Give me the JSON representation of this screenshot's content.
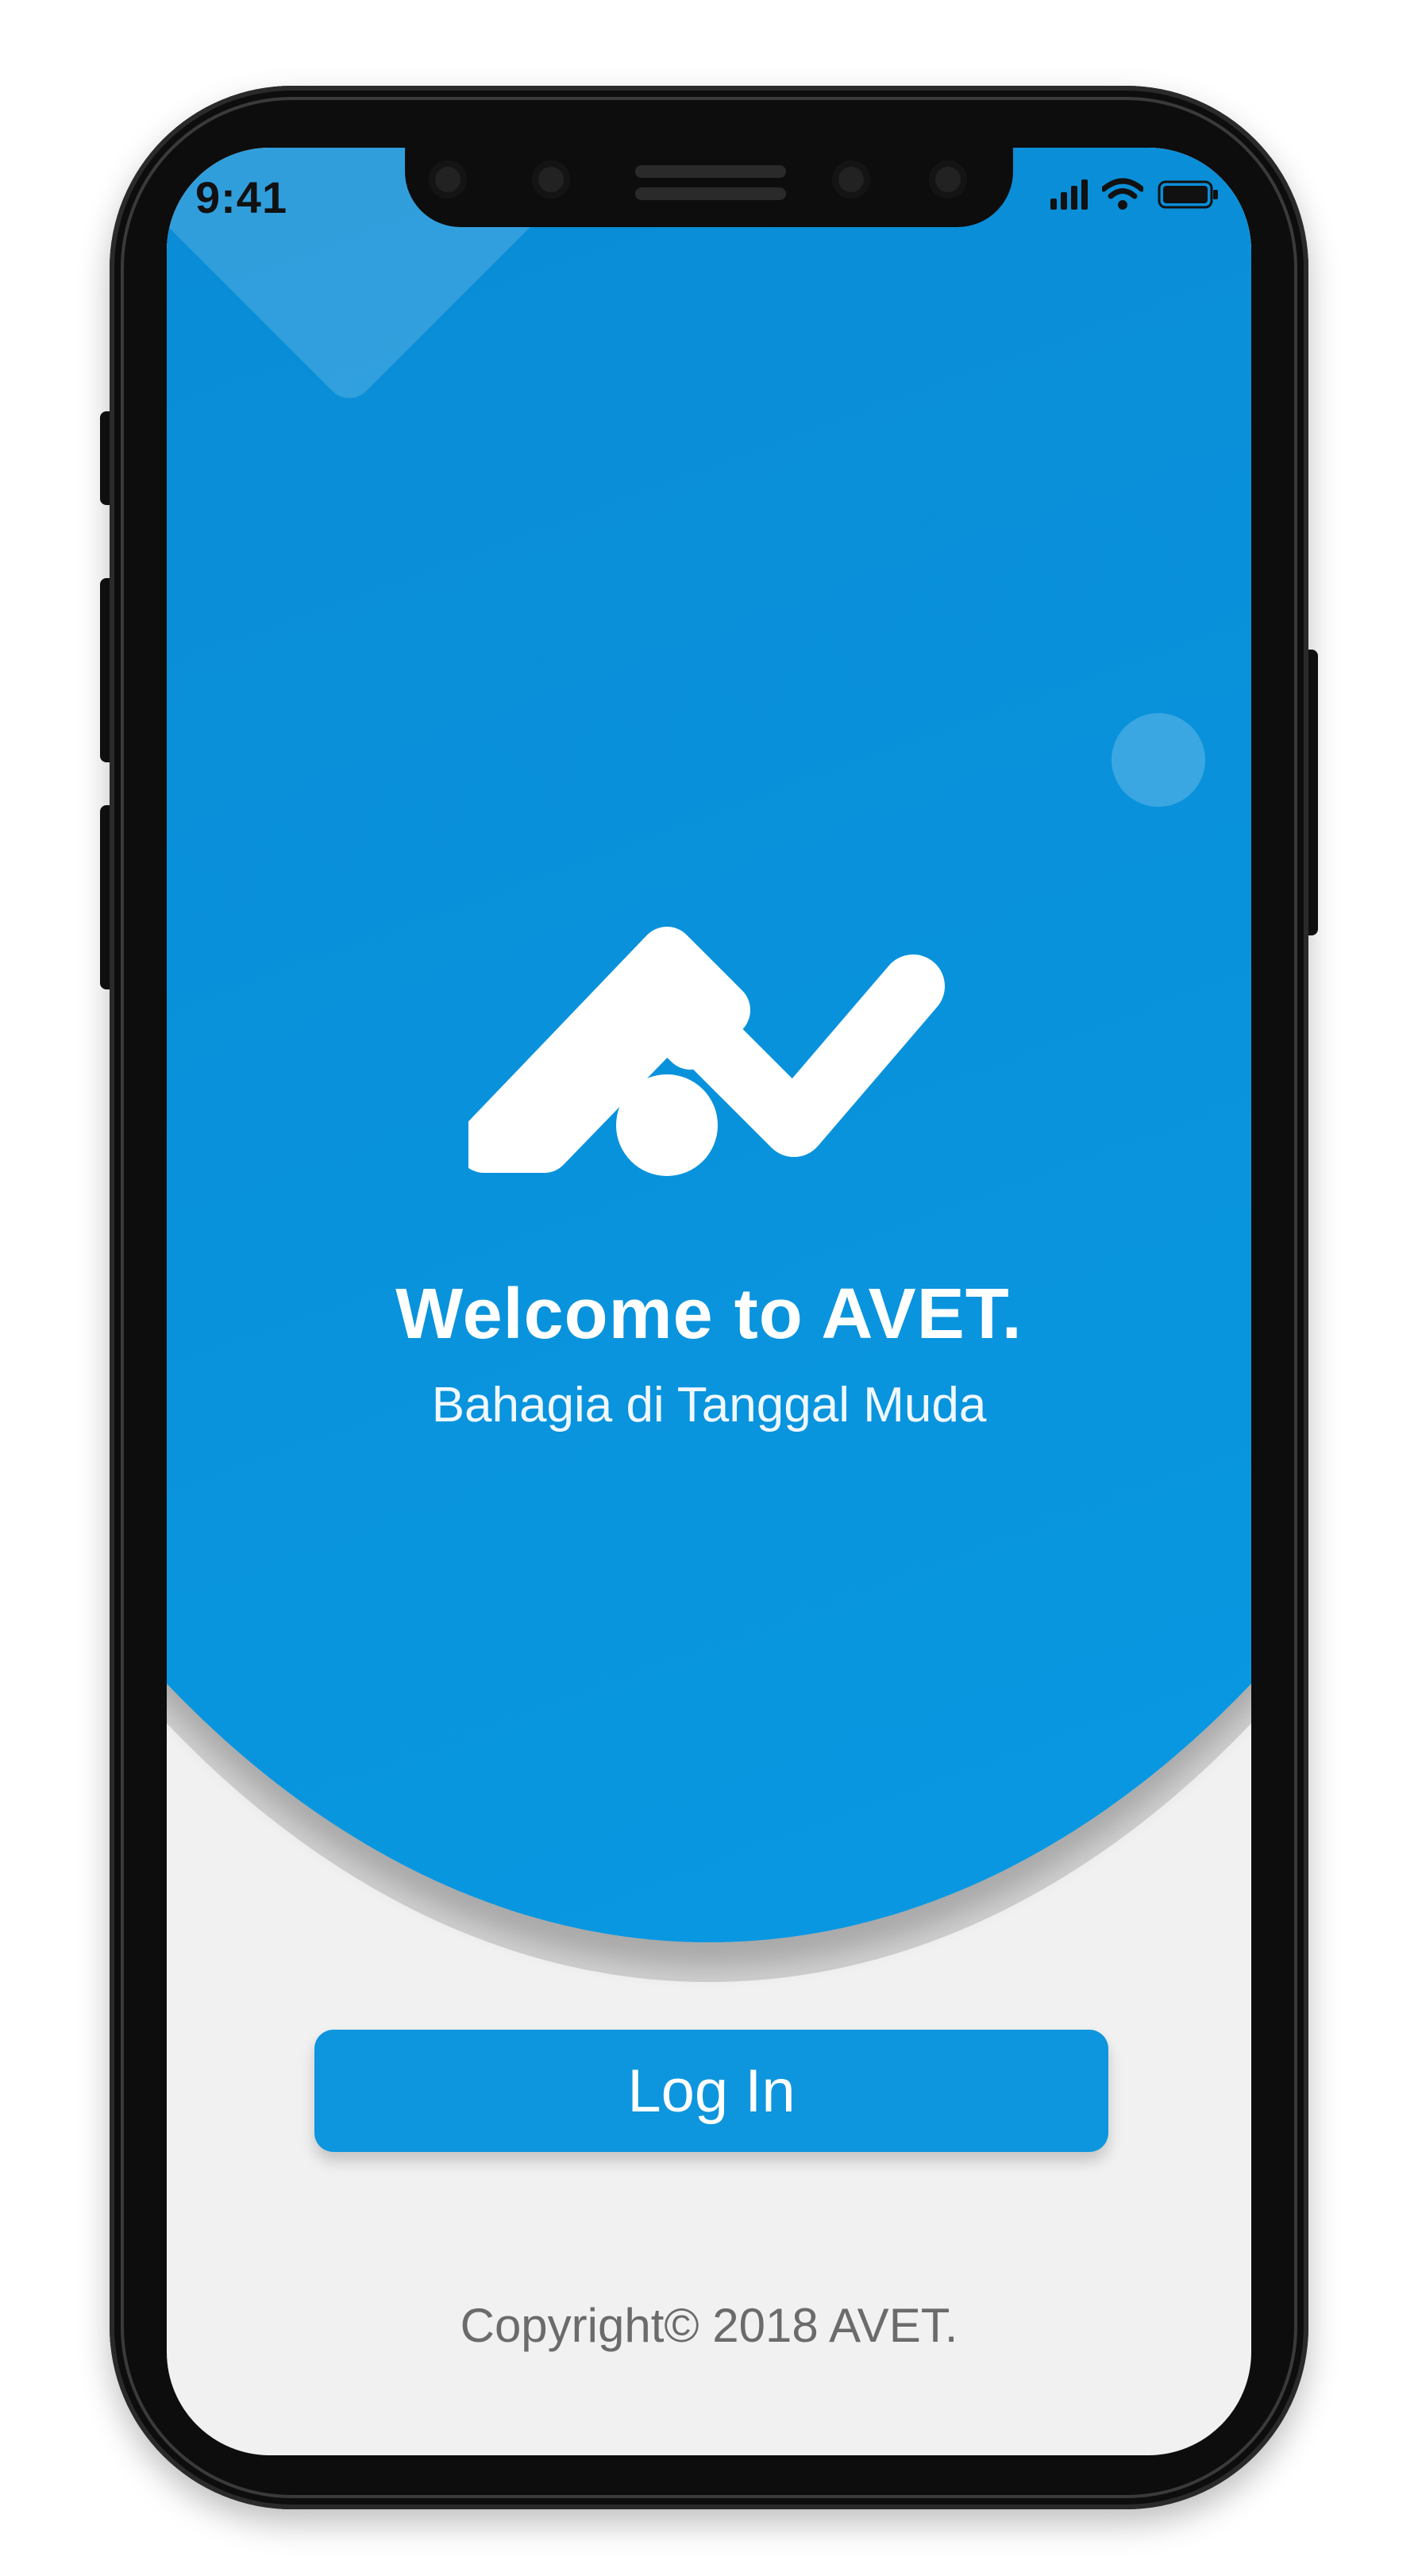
{
  "status_bar": {
    "time": "9:41",
    "icons": [
      "signal-icon",
      "wifi-icon",
      "battery-icon"
    ]
  },
  "brand": {
    "logo_icon": "avet-logo-icon",
    "title": "Welcome to AVET.",
    "tagline": "Bahagia di Tanggal Muda"
  },
  "actions": {
    "login_label": "Log In"
  },
  "footer": {
    "copyright": "Copyright© 2018 AVET."
  },
  "colors": {
    "primary": "#0d96dd",
    "background": "#f1f1f1",
    "text_light": "#ffffff",
    "text_muted": "#6b6b6b"
  }
}
